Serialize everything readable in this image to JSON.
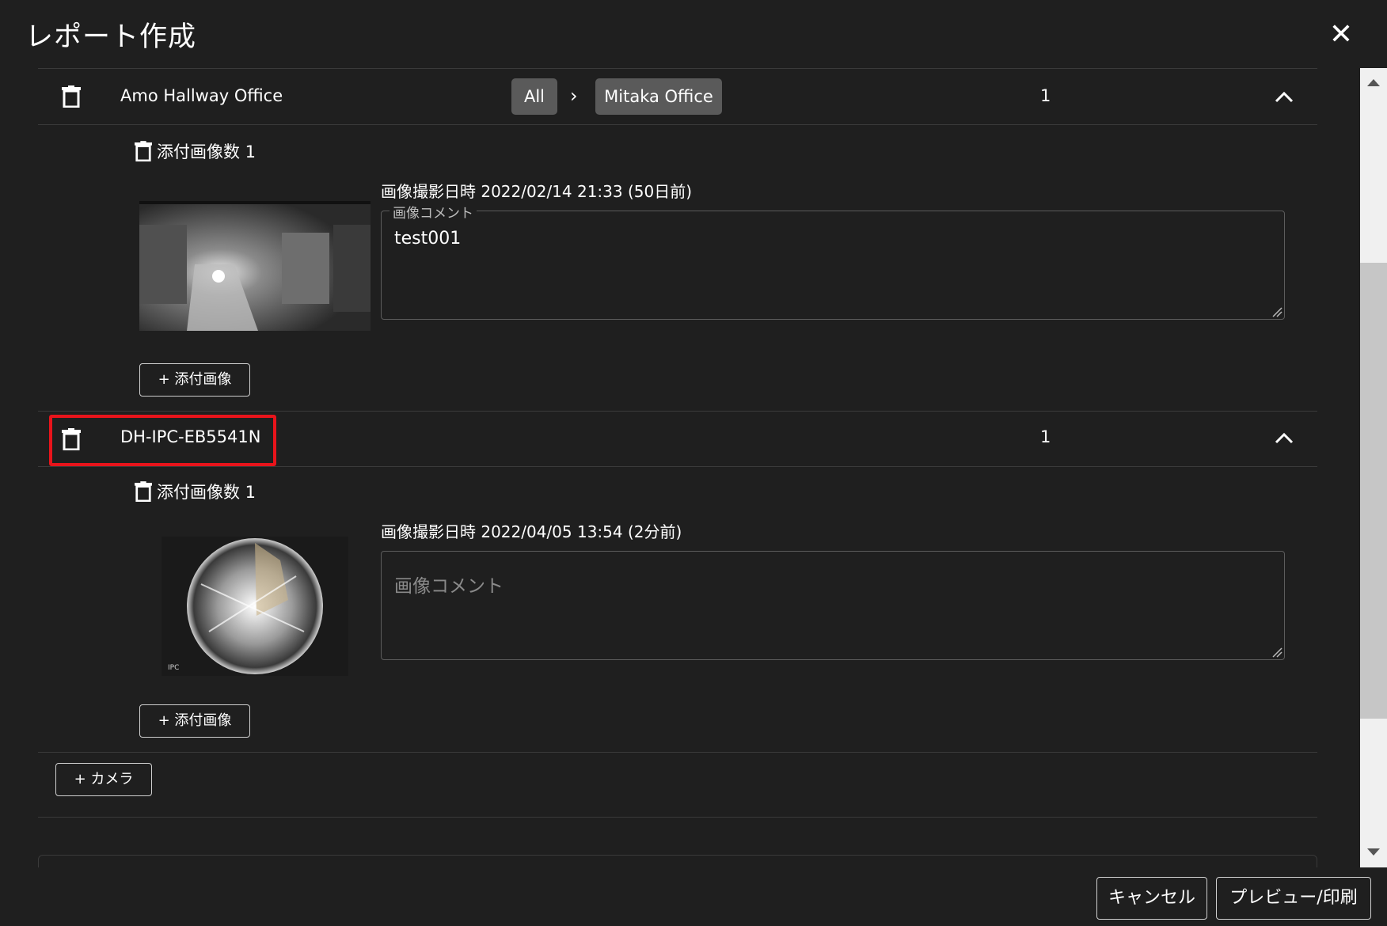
{
  "dialog": {
    "title": "レポート作成",
    "close_icon": "close-icon"
  },
  "cameras": [
    {
      "name": "Amo Hallway Office",
      "breadcrumb": [
        "All",
        "Mitaka Office"
      ],
      "count": "1",
      "attach_count_label": "添付画像数 1",
      "images": [
        {
          "shot_time": "画像撮影日時 2022/02/14 21:33 (50日前)",
          "comment_label": "画像コメント",
          "comment_value": "test001"
        }
      ],
      "add_image_label": "+ 添付画像"
    },
    {
      "name": "DH-IPC-EB5541N",
      "count": "1",
      "attach_count_label": "添付画像数 1",
      "images": [
        {
          "shot_time": "画像撮影日時 2022/04/05 13:54 (2分前)",
          "comment_placeholder": "画像コメント",
          "thumb_text": "IPC"
        }
      ],
      "add_image_label": "+ 添付画像"
    }
  ],
  "add_camera_label": "+ カメラ",
  "footer": {
    "cancel_label": "キャンセル",
    "preview_label": "プレビュー/印刷"
  },
  "colors": {
    "background": "#1f1f1f",
    "highlight": "#e8141b",
    "chip": "#5a5a5a"
  }
}
